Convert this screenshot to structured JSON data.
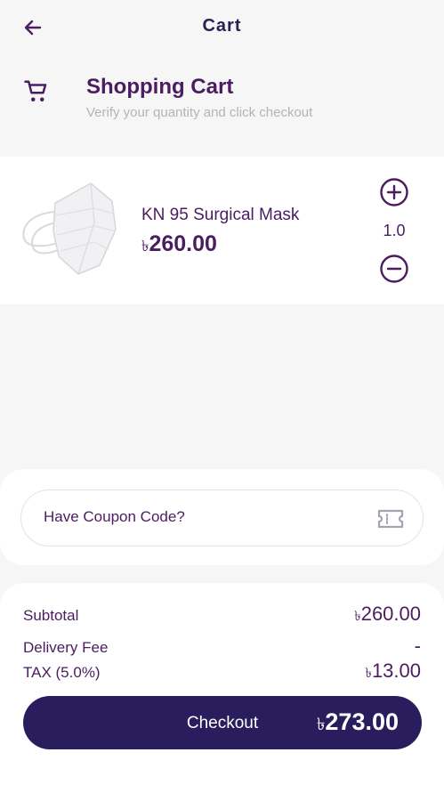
{
  "appbar": {
    "title": "Cart",
    "back_icon": "arrow-left-icon"
  },
  "header": {
    "icon": "shopping-cart-icon",
    "title": "Shopping Cart",
    "subtitle": "Verify your quantity and click checkout"
  },
  "cart_items": [
    {
      "name": "KN 95 Surgical Mask",
      "currency": "৳",
      "price": "260.00",
      "quantity": "1.0",
      "image": "mask-image"
    }
  ],
  "coupon": {
    "placeholder": "Have Coupon Code?",
    "icon": "ticket-icon"
  },
  "totals": {
    "subtotal_label": "Subtotal",
    "subtotal_currency": "৳",
    "subtotal_value": "260.00",
    "delivery_label": "Delivery Fee",
    "delivery_value": "-",
    "tax_label": "TAX (5.0%)",
    "tax_currency": "৳",
    "tax_value": "13.00"
  },
  "checkout": {
    "label": "Checkout",
    "currency": "৳",
    "total": "273.00"
  },
  "colors": {
    "primary": "#2a1d5e",
    "text": "#4a1d61",
    "muted": "#b3b3bb",
    "background": "#f6f6f7"
  }
}
